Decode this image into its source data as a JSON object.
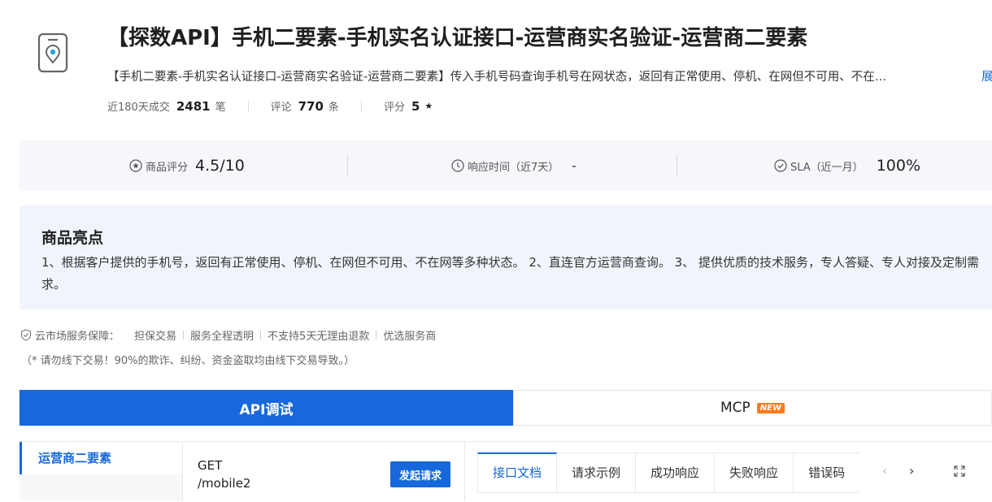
{
  "header": {
    "title": "【探数API】手机二要素-手机实名认证接口-运营商实名验证-运营商二要素",
    "description": "【手机二要素-手机实名认证接口-运营商实名验证-运营商二要素】传入手机号码查询手机号在网状态，返回有正常使用、停机、在网但不可用、不在…",
    "expand_label": "展",
    "stats": {
      "sales_label": "近180天成交",
      "sales_value": "2481",
      "sales_unit": "笔",
      "reviews_label": "评论",
      "reviews_value": "770",
      "reviews_unit": "条",
      "rating_label": "评分",
      "rating_value": "5",
      "rating_star": "★"
    }
  },
  "metrics": [
    {
      "label": "商品评分",
      "value": "4.5/10",
      "icon": "star-circle-icon"
    },
    {
      "label": "响应时间（近7天）",
      "value": "-",
      "icon": "clock-icon"
    },
    {
      "label": "SLA（近一月）",
      "value": "100%",
      "icon": "check-circle-icon"
    }
  ],
  "highlights": {
    "title": "商品亮点",
    "text": "1、根据客户提供的手机号，返回有正常使用、停机、在网但不可用、不在网等多种状态。 2、直连官方运营商查询。 3、 提供优质的技术服务，专人答疑、专人对接及定制需求。"
  },
  "guarantee": {
    "lead": "云市场服务保障：",
    "items": [
      "担保交易",
      "服务全程透明",
      "不支持5天无理由退款",
      "优选服务商"
    ],
    "warning": "（* 请勿线下交易！90%的欺诈、纠纷、资金盗取均由线下交易导致。）"
  },
  "main_tabs": {
    "api": "API调试",
    "mcp": "MCP",
    "new_badge": "NEW"
  },
  "sidebar": {
    "active_item": "运营商二要素"
  },
  "request": {
    "method": "GET",
    "path": "/mobile2",
    "send_label": "发起请求"
  },
  "doc_tabs": [
    "接口文档",
    "请求示例",
    "成功响应",
    "失败响应",
    "错误码"
  ],
  "colors": {
    "primary": "#1668dc",
    "badge": "#ff7a1a",
    "metrics_bg": "#f5f7fa",
    "highlights_bg": "#f0f5fc"
  }
}
